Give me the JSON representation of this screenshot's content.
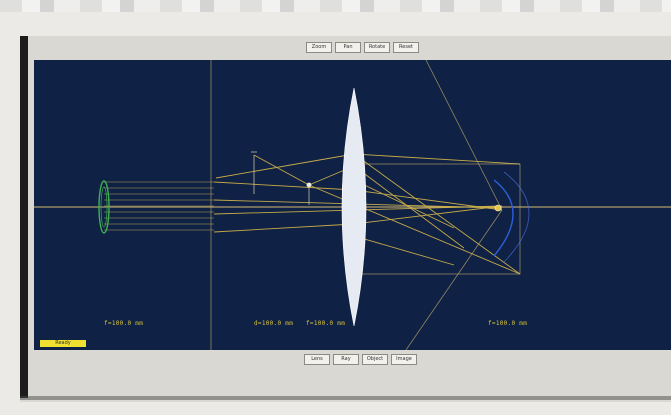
{
  "toolbar_top": [
    {
      "label": "Zoom"
    },
    {
      "label": "Pan"
    },
    {
      "label": "Rotate"
    },
    {
      "label": "Reset"
    }
  ],
  "toolbar_bottom": [
    {
      "label": "Lens"
    },
    {
      "label": "Ray"
    },
    {
      "label": "Object"
    },
    {
      "label": "Image"
    }
  ],
  "canvas": {
    "distance_labels": [
      {
        "text": "f=100.0 mm"
      },
      {
        "text": "d=100.0 mm"
      },
      {
        "text": "f=100.0 mm"
      },
      {
        "text": "f=100.0 mm"
      }
    ],
    "status": "Ready"
  },
  "colors": {
    "background": "#0f2144",
    "rays": "#d8b84a",
    "lens": "#e6eaf2",
    "source": "#3fae52",
    "wavefront": "#2f5fd8",
    "axis": "#c9b270"
  }
}
